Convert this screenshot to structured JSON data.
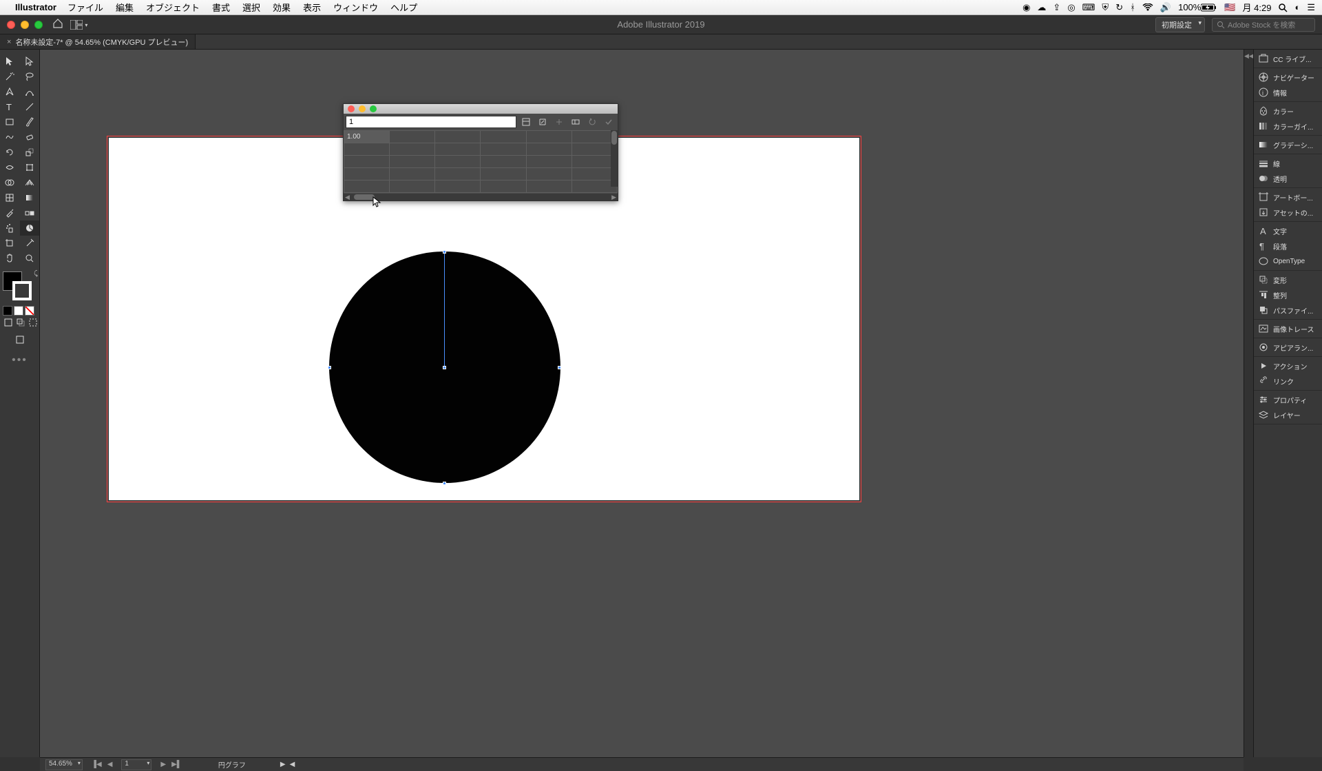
{
  "menubar": {
    "appname": "Illustrator",
    "items": [
      "ファイル",
      "編集",
      "オブジェクト",
      "書式",
      "選択",
      "効果",
      "表示",
      "ウィンドウ",
      "ヘルプ"
    ],
    "battery": "100%",
    "clock_day": "月",
    "clock_time": "4:29"
  },
  "titlebar": {
    "title": "Adobe Illustrator 2019",
    "workspace_preset": "初期設定",
    "search_placeholder": "Adobe Stock を検索"
  },
  "tab": {
    "label": "名称未設定-7* @ 54.65% (CMYK/GPU プレビュー)"
  },
  "data_panel": {
    "input_value": "1",
    "cell_value": "1.00"
  },
  "right_panels": {
    "g1": [
      {
        "icon": "library-icon",
        "label": "CC ライブ..."
      }
    ],
    "g2": [
      {
        "icon": "navigator-icon",
        "label": "ナビゲーター"
      },
      {
        "icon": "info-icon",
        "label": "情報"
      }
    ],
    "g3": [
      {
        "icon": "color-icon",
        "label": "カラー"
      },
      {
        "icon": "colorguide-icon",
        "label": "カラーガイ..."
      }
    ],
    "g4": [
      {
        "icon": "gradient-icon",
        "label": "グラデーシ..."
      }
    ],
    "g5": [
      {
        "icon": "stroke-icon",
        "label": "線"
      },
      {
        "icon": "transparency-icon",
        "label": "透明"
      }
    ],
    "g6": [
      {
        "icon": "artboard-icon",
        "label": "アートボー..."
      },
      {
        "icon": "asset-icon",
        "label": "アセットの..."
      }
    ],
    "g7": [
      {
        "icon": "character-icon",
        "label": "文字"
      },
      {
        "icon": "paragraph-icon",
        "label": "段落"
      },
      {
        "icon": "opentype-icon",
        "label": "OpenType"
      }
    ],
    "g8": [
      {
        "icon": "transform-icon",
        "label": "変形"
      },
      {
        "icon": "align-icon",
        "label": "整列"
      },
      {
        "icon": "pathfinder-icon",
        "label": "パスファイ..."
      }
    ],
    "g9": [
      {
        "icon": "imagetrace-icon",
        "label": "画像トレース"
      }
    ],
    "g10": [
      {
        "icon": "appearance-icon",
        "label": "アピアラン..."
      }
    ],
    "g11": [
      {
        "icon": "actions-icon",
        "label": "アクション"
      },
      {
        "icon": "link-icon",
        "label": "リンク"
      }
    ],
    "g12": [
      {
        "icon": "properties-icon",
        "label": "プロパティ"
      },
      {
        "icon": "layers-icon",
        "label": "レイヤー"
      }
    ]
  },
  "statusbar": {
    "zoom": "54.65%",
    "artboard_num": "1",
    "tool_name": "円グラフ"
  },
  "chart_data": {
    "type": "pie",
    "values": [
      1.0
    ],
    "title": "",
    "note": "single-slice pie (one data point = full circle)"
  }
}
